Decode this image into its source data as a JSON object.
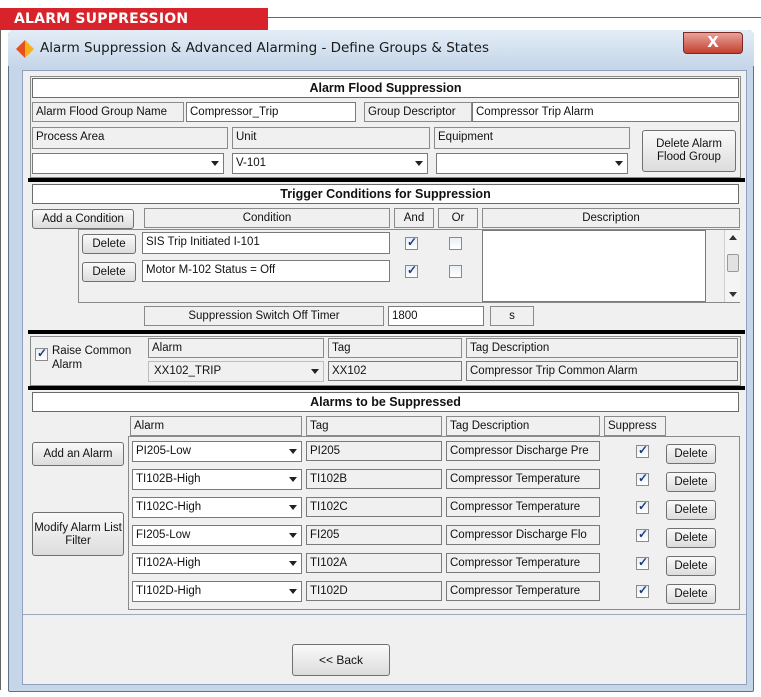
{
  "banner": {
    "label": "ALARM SUPPRESSION"
  },
  "window": {
    "title": "Alarm Suppression & Advanced Alarming - Define Groups & States",
    "close_label": "X"
  },
  "flood": {
    "header": "Alarm Flood Suppression",
    "group_name_label": "Alarm Flood Group Name",
    "group_name_value": "Compressor_Trip",
    "descriptor_label": "Group Descriptor",
    "descriptor_value": "Compressor Trip Alarm",
    "process_area_label": "Process Area",
    "process_area_value": "",
    "unit_label": "Unit",
    "unit_value": "V-101",
    "equipment_label": "Equipment",
    "equipment_value": "",
    "delete_group_label": "Delete Alarm Flood Group"
  },
  "trigger": {
    "header": "Trigger Conditions for Suppression",
    "add_condition_label": "Add a Condition",
    "col_condition": "Condition",
    "col_and": "And",
    "col_or": "Or",
    "col_description": "Description",
    "rows": [
      {
        "delete_label": "Delete",
        "condition": "SIS Trip Initiated I-101",
        "and": true,
        "or": false
      },
      {
        "delete_label": "Delete",
        "condition": "Motor M-102 Status = Off",
        "and": true,
        "or": false
      }
    ],
    "timer_label": "Suppression Switch Off Timer",
    "timer_value": "1800",
    "timer_unit": "s"
  },
  "common": {
    "raise_label": "Raise Common Alarm",
    "raise_checked": true,
    "col_alarm": "Alarm",
    "col_tag": "Tag",
    "col_tag_desc": "Tag Description",
    "alarm_value": "XX102_TRIP",
    "tag_value": "XX102",
    "tag_desc_value": "Compressor Trip Common Alarm"
  },
  "suppressed": {
    "header": "Alarms to be Suppressed",
    "add_alarm_label": "Add an Alarm",
    "modify_filter_label": "Modify Alarm List Filter",
    "col_alarm": "Alarm",
    "col_tag": "Tag",
    "col_tag_desc": "Tag Description",
    "col_suppress": "Suppress",
    "rows": [
      {
        "alarm": "PI205-Low",
        "tag": "PI205",
        "desc": "Compressor Discharge Pre",
        "suppress": true,
        "delete_label": "Delete"
      },
      {
        "alarm": "TI102B-High",
        "tag": "TI102B",
        "desc": "Compressor Temperature",
        "suppress": true,
        "delete_label": "Delete"
      },
      {
        "alarm": "TI102C-High",
        "tag": "TI102C",
        "desc": "Compressor Temperature",
        "suppress": true,
        "delete_label": "Delete"
      },
      {
        "alarm": "FI205-Low",
        "tag": "FI205",
        "desc": "Compressor Discharge Flo",
        "suppress": true,
        "delete_label": "Delete"
      },
      {
        "alarm": "TI102A-High",
        "tag": "TI102A",
        "desc": "Compressor Temperature",
        "suppress": true,
        "delete_label": "Delete"
      },
      {
        "alarm": "TI102D-High",
        "tag": "TI102D",
        "desc": "Compressor Temperature",
        "suppress": true,
        "delete_label": "Delete"
      }
    ]
  },
  "footer": {
    "back_label": "<< Back"
  },
  "colors": {
    "banner": "#d8232a",
    "window_frame": "#c6d6e8",
    "client_bg": "#f0f0f0",
    "close": "#c4402f"
  }
}
